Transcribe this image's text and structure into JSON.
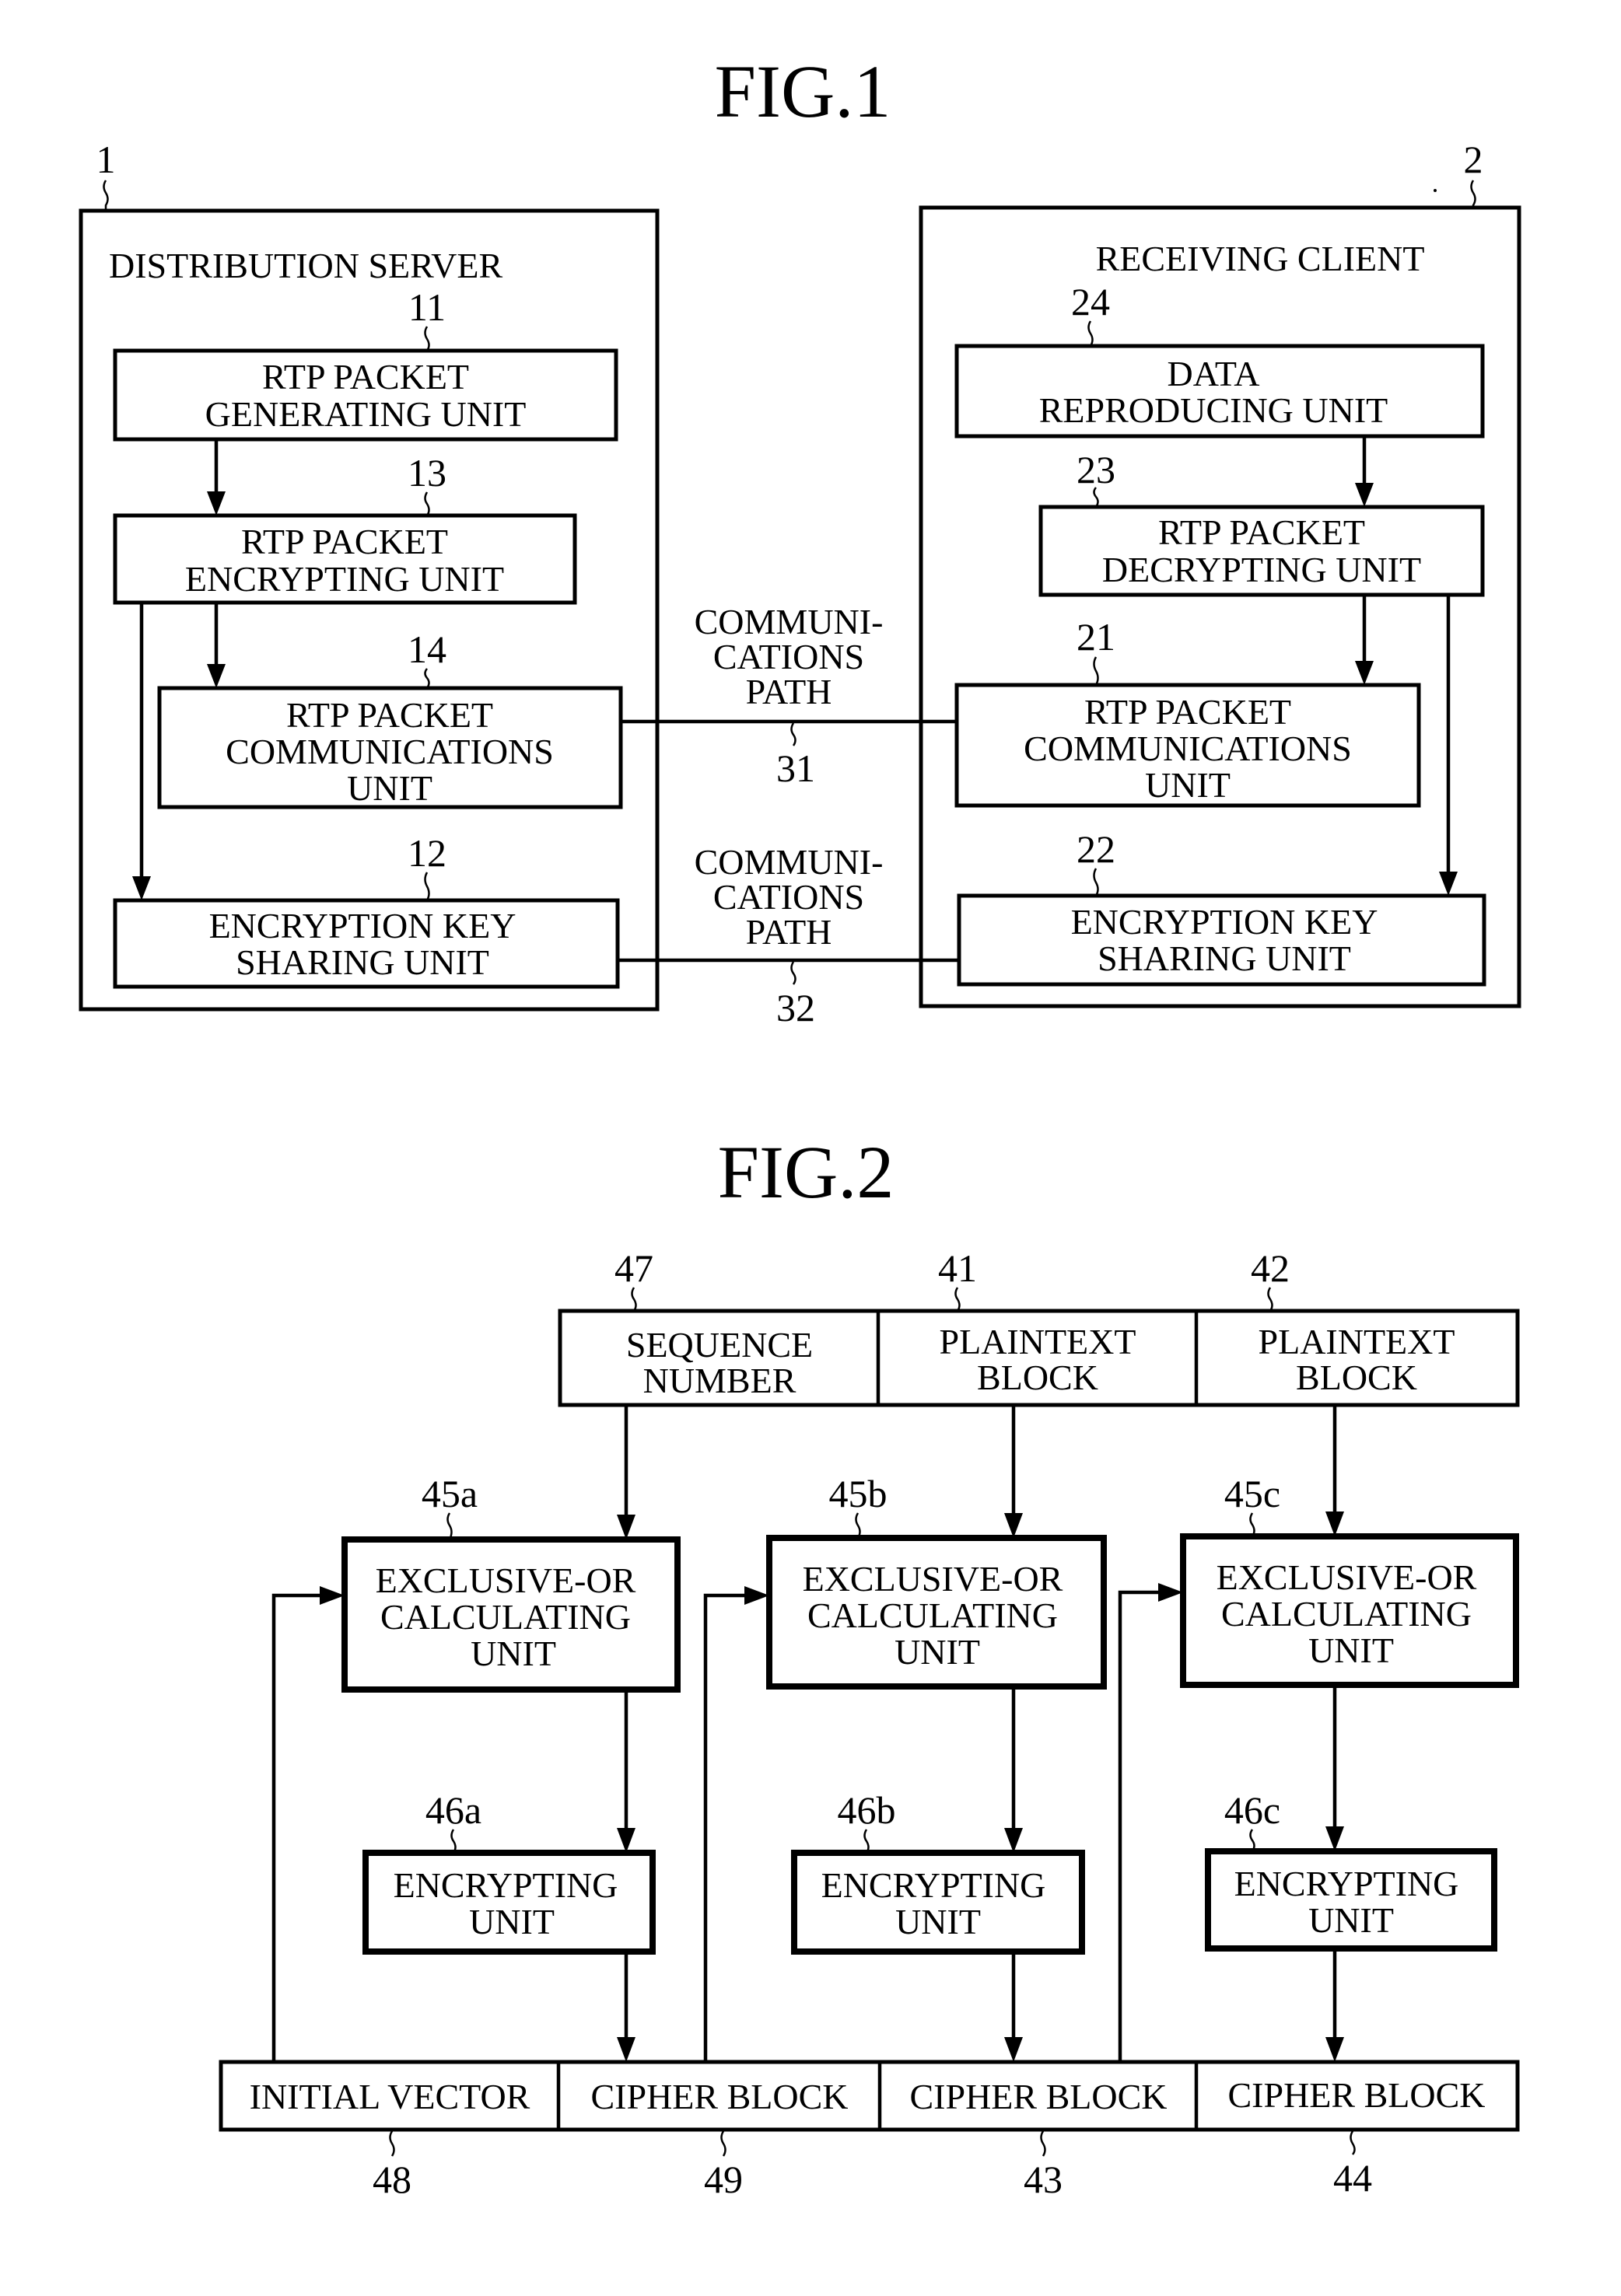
{
  "fig1": {
    "title": "FIG.1",
    "server": {
      "ref": "1",
      "label": "DISTRIBUTION SERVER",
      "units": {
        "generating": {
          "ref": "11",
          "lines": [
            "RTP PACKET",
            "GENERATING UNIT"
          ]
        },
        "encrypting": {
          "ref": "13",
          "lines": [
            "RTP PACKET",
            "ENCRYPTING UNIT"
          ]
        },
        "communications": {
          "ref": "14",
          "lines": [
            "RTP PACKET",
            "COMMUNICATIONS",
            "UNIT"
          ]
        },
        "key_sharing": {
          "ref": "12",
          "lines": [
            "ENCRYPTION KEY",
            "SHARING UNIT"
          ]
        }
      }
    },
    "client": {
      "ref": "2",
      "label": "RECEIVING CLIENT",
      "units": {
        "reproducing": {
          "ref": "24",
          "lines": [
            "DATA",
            "REPRODUCING UNIT"
          ]
        },
        "decrypting": {
          "ref": "23",
          "lines": [
            "RTP PACKET",
            "DECRYPTING UNIT"
          ]
        },
        "communications": {
          "ref": "21",
          "lines": [
            "RTP PACKET",
            "COMMUNICATIONS",
            "UNIT"
          ]
        },
        "key_sharing": {
          "ref": "22",
          "lines": [
            "ENCRYPTION KEY",
            "SHARING UNIT"
          ]
        }
      }
    },
    "paths": [
      {
        "ref": "31",
        "lines": [
          "COMMUNI-",
          "CATIONS",
          "PATH"
        ]
      },
      {
        "ref": "32",
        "lines": [
          "COMMUNI-",
          "CATIONS",
          "PATH"
        ]
      }
    ]
  },
  "fig2": {
    "title": "FIG.2",
    "input_row": [
      {
        "ref": "47",
        "lines": [
          "SEQUENCE",
          "NUMBER"
        ]
      },
      {
        "ref": "41",
        "lines": [
          "PLAINTEXT",
          "BLOCK"
        ]
      },
      {
        "ref": "42",
        "lines": [
          "PLAINTEXT",
          "BLOCK"
        ]
      }
    ],
    "xor_units": [
      {
        "ref": "45a",
        "lines": [
          "EXCLUSIVE-OR",
          "CALCULATING",
          "UNIT"
        ]
      },
      {
        "ref": "45b",
        "lines": [
          "EXCLUSIVE-OR",
          "CALCULATING",
          "UNIT"
        ]
      },
      {
        "ref": "45c",
        "lines": [
          "EXCLUSIVE-OR",
          "CALCULATING",
          "UNIT"
        ]
      }
    ],
    "encrypting_units": [
      {
        "ref": "46a",
        "lines": [
          "ENCRYPTING",
          "UNIT"
        ]
      },
      {
        "ref": "46b",
        "lines": [
          "ENCRYPTING",
          "UNIT"
        ]
      },
      {
        "ref": "46c",
        "lines": [
          "ENCRYPTING",
          "UNIT"
        ]
      }
    ],
    "output_row": [
      {
        "ref": "48",
        "label": "INITIAL VECTOR"
      },
      {
        "ref": "49",
        "label": "CIPHER BLOCK"
      },
      {
        "ref": "43",
        "label": "CIPHER BLOCK"
      },
      {
        "ref": "44",
        "label": "CIPHER BLOCK"
      }
    ]
  }
}
